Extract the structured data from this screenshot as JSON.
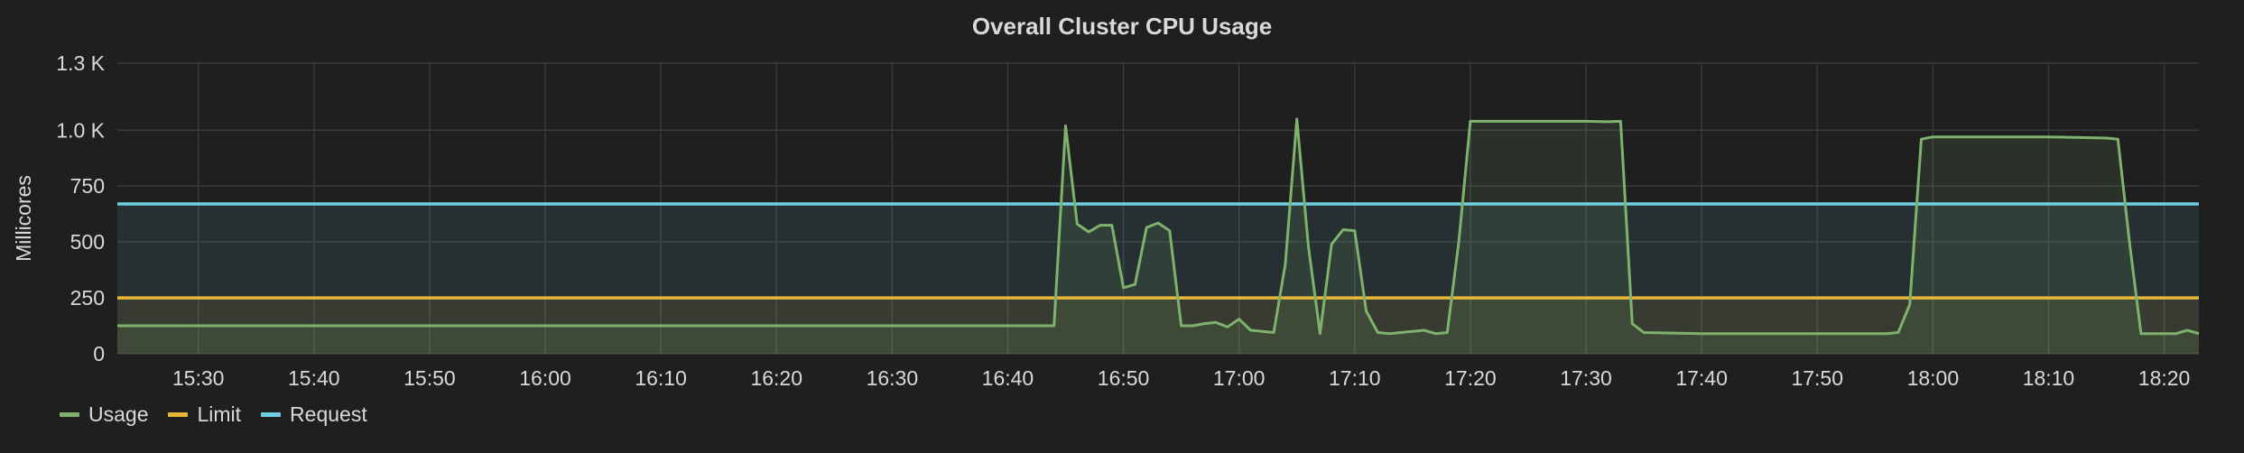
{
  "chart_data": {
    "type": "line",
    "title": "Overall Cluster CPU Usage",
    "ylabel": "Millicores",
    "ylim": [
      0,
      1300
    ],
    "yticks": [
      0,
      250,
      500,
      750,
      1000,
      1300
    ],
    "ytick_labels": [
      "0",
      "250",
      "500",
      "750",
      "1.0 K",
      "1.3 K"
    ],
    "xlim": [
      "15:23",
      "18:23"
    ],
    "xtick_labels": [
      "15:30",
      "15:40",
      "15:50",
      "16:00",
      "16:10",
      "16:20",
      "16:30",
      "16:40",
      "16:50",
      "17:00",
      "17:10",
      "17:20",
      "17:30",
      "17:40",
      "17:50",
      "18:00",
      "18:10",
      "18:20"
    ],
    "grid": true,
    "legend_position": "bottom-left",
    "series": [
      {
        "name": "Usage",
        "color": "#7eb26d",
        "fill": true,
        "x": [
          "15:23",
          "15:30",
          "15:40",
          "15:50",
          "16:00",
          "16:10",
          "16:20",
          "16:30",
          "16:40",
          "16:44",
          "16:45",
          "16:46",
          "16:47",
          "16:48",
          "16:49",
          "16:50",
          "16:51",
          "16:52",
          "16:53",
          "16:54",
          "16:55",
          "16:56",
          "16:57",
          "16:58",
          "16:59",
          "17:00",
          "17:01",
          "17:02",
          "17:03",
          "17:04",
          "17:05",
          "17:06",
          "17:07",
          "17:08",
          "17:09",
          "17:10",
          "17:11",
          "17:12",
          "17:13",
          "17:14",
          "17:15",
          "17:16",
          "17:17",
          "17:18",
          "17:19",
          "17:20",
          "17:25",
          "17:30",
          "17:32",
          "17:33",
          "17:34",
          "17:35",
          "17:40",
          "17:45",
          "17:50",
          "17:56",
          "17:57",
          "17:58",
          "17:59",
          "18:00",
          "18:05",
          "18:10",
          "18:15",
          "18:16",
          "18:17",
          "18:18",
          "18:20",
          "18:21",
          "18:22",
          "18:23"
        ],
        "values": [
          125,
          125,
          125,
          125,
          125,
          125,
          125,
          125,
          125,
          125,
          1020,
          580,
          545,
          575,
          575,
          295,
          310,
          565,
          585,
          550,
          125,
          125,
          135,
          140,
          120,
          155,
          105,
          100,
          95,
          400,
          1050,
          480,
          90,
          490,
          555,
          550,
          190,
          95,
          90,
          95,
          100,
          105,
          90,
          95,
          500,
          1040,
          1040,
          1040,
          1038,
          1040,
          135,
          95,
          90,
          90,
          90,
          90,
          95,
          220,
          960,
          970,
          970,
          970,
          965,
          960,
          500,
          90,
          90,
          90,
          105,
          90
        ]
      },
      {
        "name": "Limit",
        "color": "#eab839",
        "fill": true,
        "x": [
          "15:23",
          "18:23"
        ],
        "values": [
          250,
          250
        ]
      },
      {
        "name": "Request",
        "color": "#6ed0e0",
        "fill": true,
        "x": [
          "15:23",
          "18:23"
        ],
        "values": [
          670,
          670
        ]
      }
    ]
  }
}
